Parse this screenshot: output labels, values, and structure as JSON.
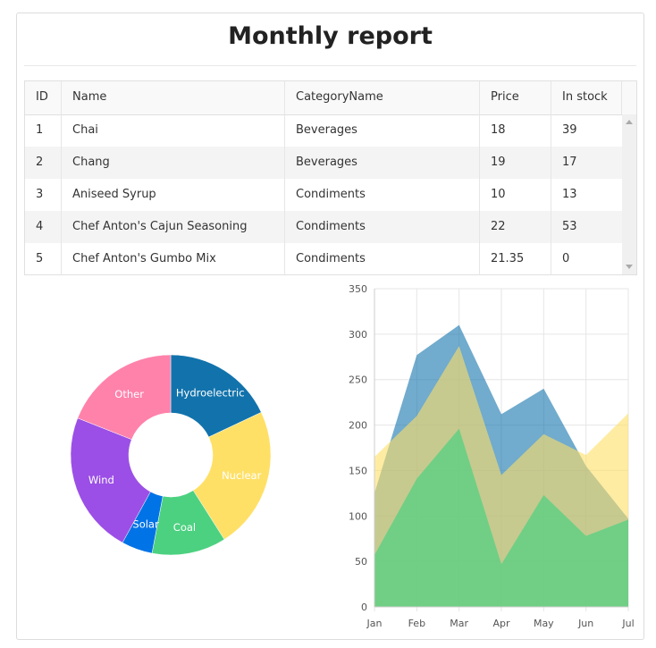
{
  "title": "Monthly report",
  "table": {
    "columns": [
      "ID",
      "Name",
      "CategoryName",
      "Price",
      "In stock"
    ],
    "rows": [
      [
        "1",
        "Chai",
        "Beverages",
        "18",
        "39"
      ],
      [
        "2",
        "Chang",
        "Beverages",
        "19",
        "17"
      ],
      [
        "3",
        "Aniseed Syrup",
        "Condiments",
        "10",
        "13"
      ],
      [
        "4",
        "Chef Anton's Cajun Seasoning",
        "Condiments",
        "22",
        "53"
      ],
      [
        "5",
        "Chef Anton's Gumbo Mix",
        "Condiments",
        "21.35",
        "0"
      ]
    ]
  },
  "chart_data": [
    {
      "type": "pie",
      "donut": true,
      "categories": [
        "Hydroelectric",
        "Nuclear",
        "Coal",
        "Solar",
        "Wind",
        "Other"
      ],
      "values": [
        18,
        23,
        12,
        5,
        23,
        19
      ],
      "colors": [
        "#1273ac",
        "#ffe066",
        "#4cd180",
        "#0073e6",
        "#9b4fe6",
        "#ff82ab"
      ]
    },
    {
      "type": "area",
      "categories": [
        "Jan",
        "Feb",
        "Mar",
        "Apr",
        "May",
        "Jun",
        "Jul"
      ],
      "ylim": [
        0,
        350
      ],
      "yticks": [
        0,
        50,
        100,
        150,
        200,
        250,
        300,
        350
      ],
      "grid": true,
      "series": [
        {
          "values": [
            125,
            277,
            310,
            212,
            240,
            155,
            97
          ],
          "color": "#1273ac"
        },
        {
          "values": [
            165,
            210,
            287,
            145,
            190,
            167,
            213
          ],
          "color": "#ffe066"
        },
        {
          "values": [
            57,
            141,
            196,
            47,
            123,
            78,
            96
          ],
          "color": "#4cd180"
        }
      ]
    }
  ]
}
